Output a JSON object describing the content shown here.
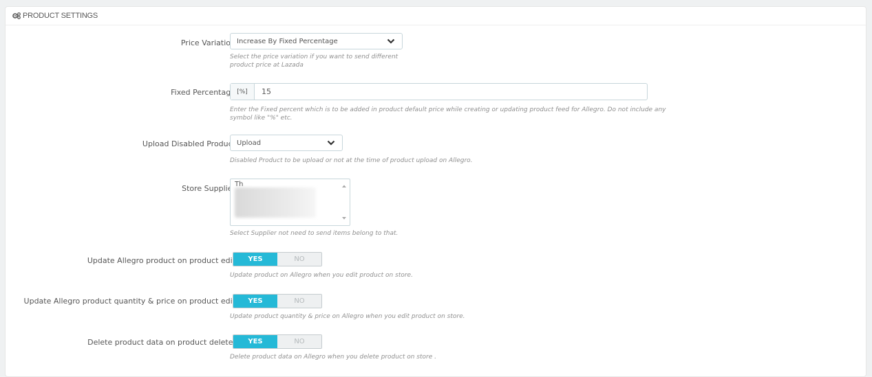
{
  "panel": {
    "title": "PRODUCT SETTINGS"
  },
  "price_variation": {
    "label": "Price Variation",
    "value": "Increase By Fixed Percentage",
    "help_line1": "Select the price variation if you want to send different",
    "help_line2": "product price at Lazada"
  },
  "fixed_percentage": {
    "label": "Fixed Percentage",
    "addon": "[%]",
    "value": "15",
    "help_line1": "Enter the Fixed percent which is to be added in product default price while creating or updating product feed for Allegro. Do not include any",
    "help_line2": "symbol like \"%\" etc."
  },
  "upload_disabled": {
    "label": "Upload Disabled Product",
    "value": "Upload",
    "help": "Disabled Product to be upload or not at the time of product upload on Allegro."
  },
  "store_supplier": {
    "label": "Store Supplier",
    "first_option": "Th",
    "help": "Select Supplier not need to send items belong to that."
  },
  "update_on_edit": {
    "label": "Update Allegro product on product edit",
    "yes": "YES",
    "no": "NO",
    "help": "Update product on Allegro when you edit product on store."
  },
  "update_qty_price": {
    "label": "Update Allegro product quantity & price on product edit",
    "yes": "YES",
    "no": "NO",
    "help": "Update product quantity & price on Allegro when you edit product on store."
  },
  "delete_on_delete": {
    "label": "Delete product data on product delete.",
    "yes": "YES",
    "no": "NO",
    "help": "Delete product data on Allegro when you delete product on store ."
  },
  "colors": {
    "accent": "#25b9d7",
    "border": "#c7d6db"
  },
  "icons": {
    "heading": "cogs-icon",
    "select": "chevron-down-icon"
  }
}
